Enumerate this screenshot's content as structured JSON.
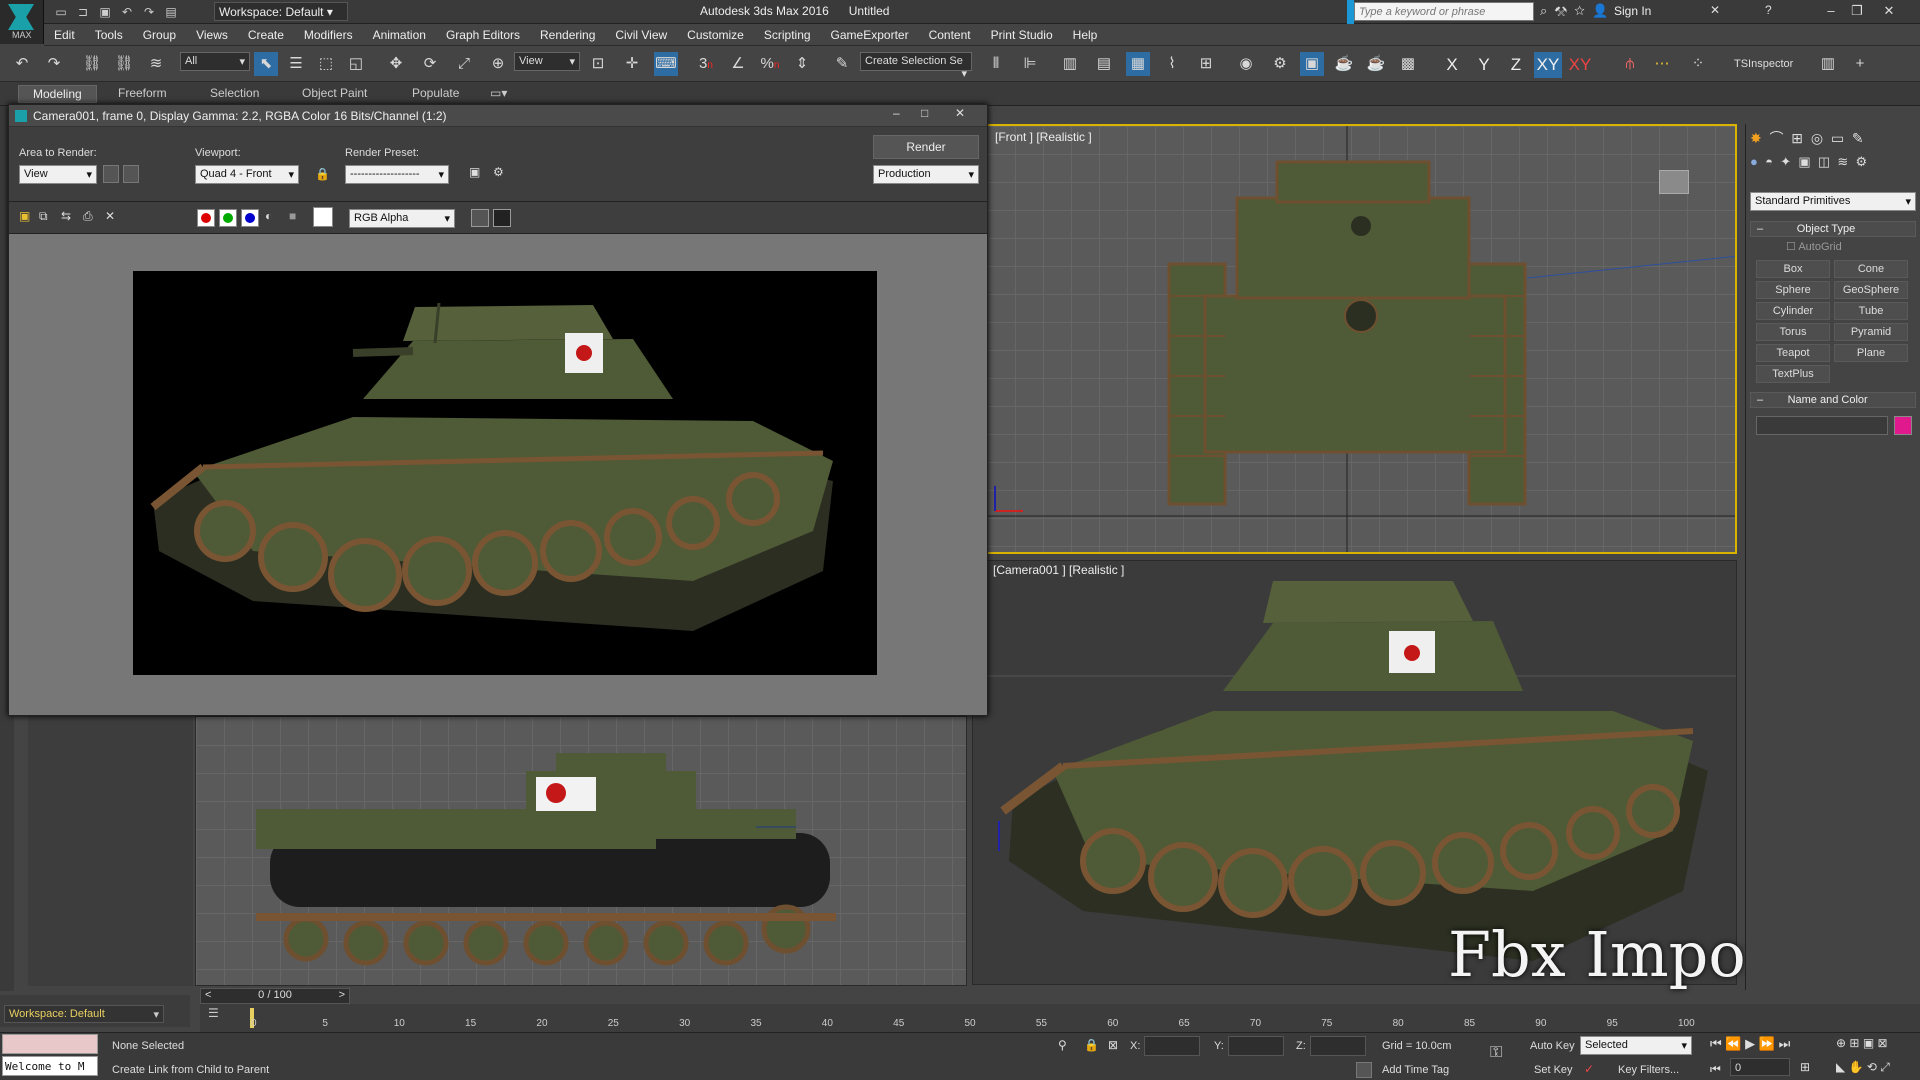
{
  "titlebar": {
    "logo_text": "MAX",
    "workspace": "Workspace: Default",
    "app_name": "Autodesk 3ds Max 2016",
    "doc_name": "Untitled",
    "search_placeholder": "Type a keyword or phrase",
    "sign_in": "Sign In"
  },
  "menu": [
    "Edit",
    "Tools",
    "Group",
    "Views",
    "Create",
    "Modifiers",
    "Animation",
    "Graph Editors",
    "Rendering",
    "Civil View",
    "Customize",
    "Scripting",
    "GameExporter",
    "Content",
    "Print Studio",
    "Help"
  ],
  "toolbar": {
    "selection_filter": "All",
    "ref_coord": "View",
    "named_selection": "Create Selection Se",
    "axes": [
      "X",
      "Y",
      "Z",
      "XY",
      "XY"
    ],
    "ts_inspector": "TSInspector",
    "snap_3": "3",
    "snap_pct": "%",
    "snap_n": "n"
  },
  "ribbon": {
    "tabs": [
      "Modeling",
      "Freeform",
      "Selection",
      "Object Paint",
      "Populate"
    ],
    "active": "Modeling"
  },
  "render_frame": {
    "title": "Camera001, frame 0, Display Gamma: 2.2, RGBA Color 16 Bits/Channel (1:2)",
    "area_label": "Area to Render:",
    "area_value": "View",
    "viewport_label": "Viewport:",
    "viewport_value": "Quad 4 - Front",
    "preset_label": "Render Preset:",
    "preset_value": "-------------------",
    "render_button": "Render",
    "production_value": "Production",
    "channel_value": "RGB Alpha"
  },
  "viewports": {
    "front_label": "[Front ] [Realistic ]",
    "camera_label": "[Camera001 ] [Realistic ]"
  },
  "command_panel": {
    "category": "Standard Primitives",
    "object_type_title": "Object Type",
    "autogrid": "AutoGrid",
    "buttons": [
      "Box",
      "Cone",
      "Sphere",
      "GeoSphere",
      "Cylinder",
      "Tube",
      "Torus",
      "Pyramid",
      "Teapot",
      "Plane",
      "TextPlus"
    ],
    "name_color_title": "Name and Color",
    "object_color": "#e0198c"
  },
  "timeline": {
    "frame_counter": "0 / 100",
    "ticks": [
      "0",
      "5",
      "10",
      "15",
      "20",
      "25",
      "30",
      "35",
      "40",
      "45",
      "50",
      "55",
      "60",
      "65",
      "70",
      "75",
      "80",
      "85",
      "90",
      "95",
      "100"
    ]
  },
  "status": {
    "workspace": "Workspace: Default",
    "maxscript": "Welcome to M",
    "selection": "None Selected",
    "prompt": "Create Link from Child to Parent",
    "x_label": "X:",
    "y_label": "Y:",
    "z_label": "Z:",
    "grid": "Grid = 10.0cm",
    "add_time_tag": "Add Time Tag",
    "auto_key": "Auto Key",
    "set_key": "Set Key",
    "selected": "Selected",
    "key_filters": "Key Filters...",
    "frame_value": "0"
  },
  "overlay_text": "Fbx Import",
  "colors": {
    "accent": "#1c97d5",
    "tank_green": "#4f5a36",
    "rust": "#7a5533",
    "object_color": "#e0198c"
  }
}
